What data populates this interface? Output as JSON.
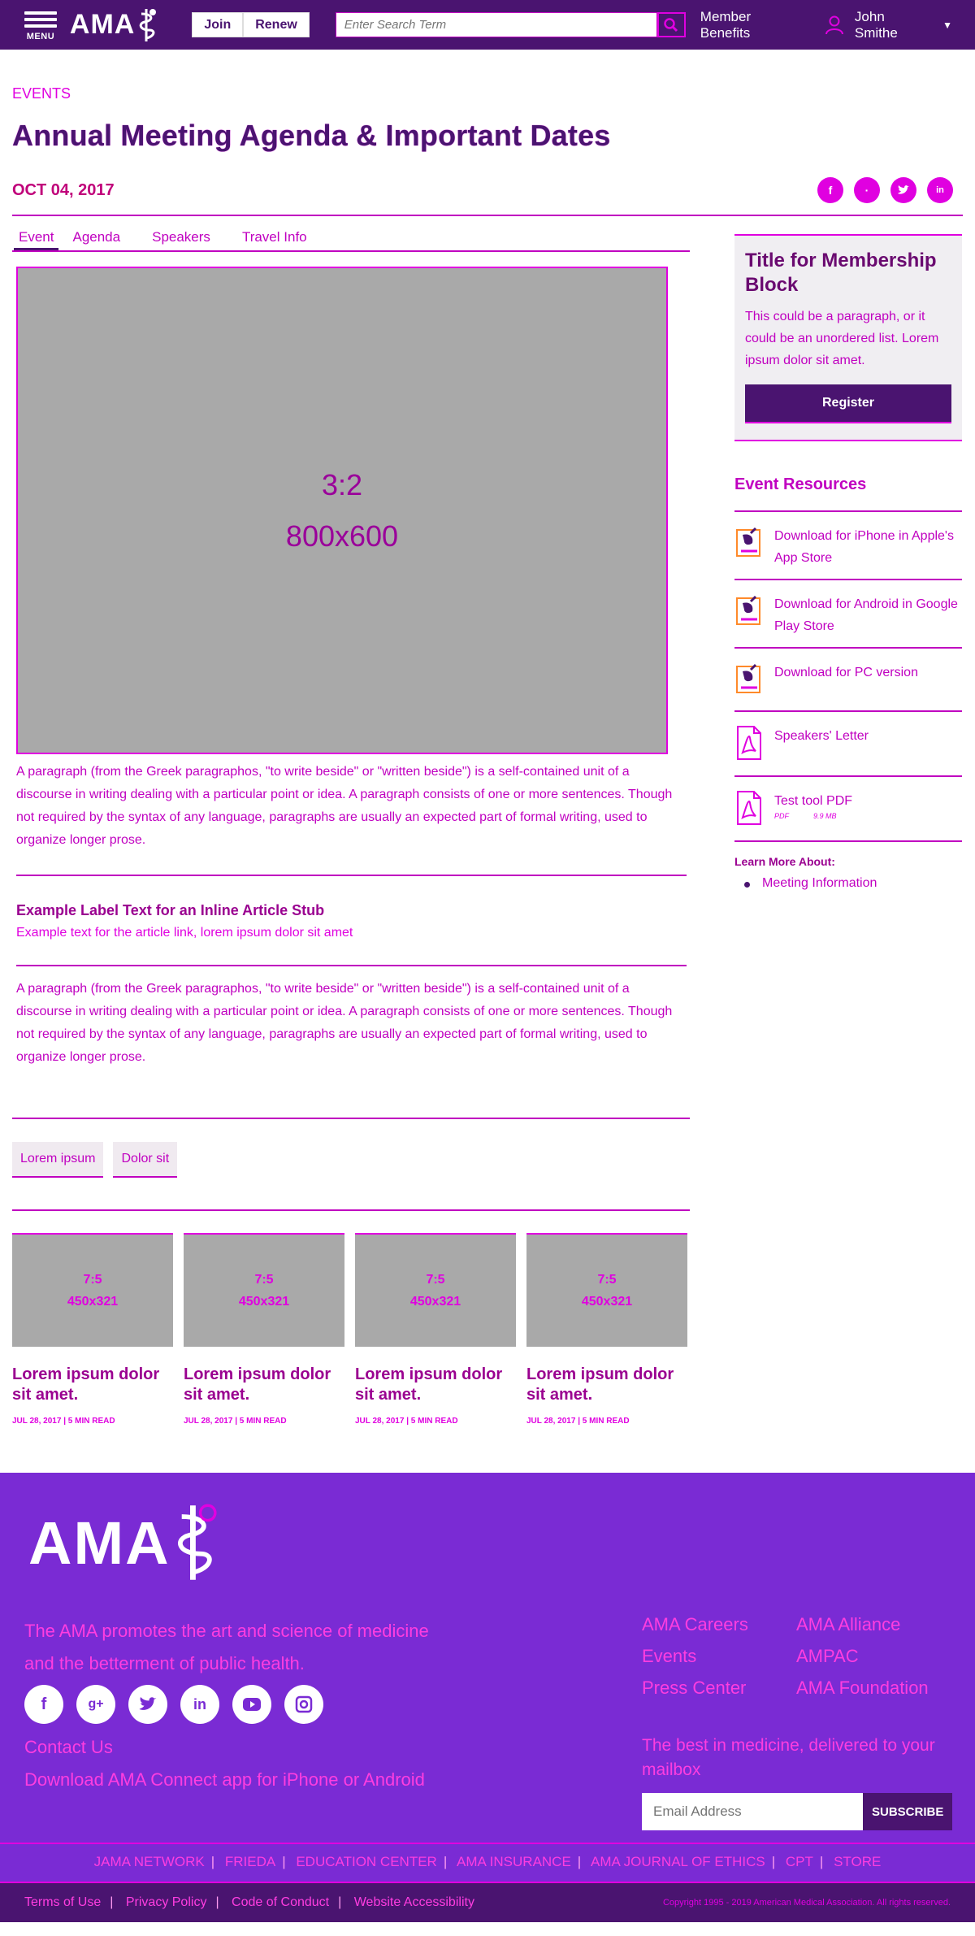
{
  "header": {
    "menu_label": "MENU",
    "logo": "AMA",
    "join_label": "Join",
    "renew_label": "Renew",
    "search_placeholder": "Enter Search Term",
    "member_benefits": "Member Benefits",
    "user_name": "John Smithe"
  },
  "page": {
    "eyebrow": "EVENTS",
    "title": "Annual Meeting Agenda & Important Dates",
    "date": "OCT 04, 2017",
    "share_icons": [
      "facebook",
      "google-plus",
      "twitter",
      "linkedin"
    ]
  },
  "tabs": [
    "Event",
    "Agenda",
    "Speakers",
    "Travel Info"
  ],
  "hero": {
    "ratio": "3:2",
    "size": "800x600"
  },
  "paragraph": "A paragraph (from the Greek paragraphos, \"to write beside\" or \"written beside\") is a self-contained unit of a discourse in writing dealing with a particular point or idea. A paragraph consists of one or more sentences. Though not required by the syntax of any language, paragraphs are usually an expected part of formal writing, used to organize longer prose.",
  "stub": {
    "label": "Example Label Text for an Inline Article Stub",
    "text": "Example text for the article link, lorem ipsum dolor sit amet"
  },
  "tags": [
    "Lorem ipsum",
    "Dolor sit"
  ],
  "cards": [
    {
      "ratio": "7:5",
      "size": "450x321",
      "title": "Lorem ipsum dolor sit amet.",
      "meta": "JUL 28, 2017 | 5 MIN READ"
    },
    {
      "ratio": "7:5",
      "size": "450x321",
      "title": "Lorem ipsum dolor sit amet.",
      "meta": "JUL 28, 2017 | 5 MIN READ"
    },
    {
      "ratio": "7:5",
      "size": "450x321",
      "title": "Lorem ipsum dolor sit amet.",
      "meta": "JUL 28, 2017 | 5 MIN READ"
    },
    {
      "ratio": "7:5",
      "size": "450x321",
      "title": "Lorem ipsum dolor sit amet.",
      "meta": "JUL 28, 2017 | 5 MIN READ"
    }
  ],
  "membership": {
    "title": "Title for Membership Block",
    "text": "This could be a paragraph, or it could be an unordered list. Lorem ipsum dolor sit amet.",
    "button": "Register"
  },
  "resources": {
    "heading": "Event Resources",
    "items": [
      {
        "icon": "app-download-icon",
        "label": "Download for iPhone in Apple's App Store"
      },
      {
        "icon": "app-download-icon",
        "label": "Download for Android in Google Play Store"
      },
      {
        "icon": "app-download-icon",
        "label": "Download for PC version"
      },
      {
        "icon": "pdf-icon",
        "label": "Speakers' Letter"
      },
      {
        "icon": "pdf-icon",
        "label": "Test tool PDF",
        "file_type": "PDF",
        "file_size": "9.9 MB"
      }
    ]
  },
  "learn_more": {
    "heading": "Learn More About:",
    "items": [
      "Meeting Information"
    ]
  },
  "footer": {
    "logo": "AMA",
    "tagline": "The AMA promotes the art and science of medicine and the betterment of public health.",
    "social": [
      "facebook",
      "google-plus",
      "twitter",
      "linkedin",
      "youtube",
      "instagram"
    ],
    "contact": "Contact Us",
    "app_text": "Download AMA Connect app for iPhone or Android",
    "links": [
      "AMA Careers",
      "AMA Alliance",
      "Events",
      "AMPAC",
      "Press Center",
      "AMA Foundation"
    ],
    "newsletter": "The best in medicine, delivered to your mailbox",
    "email_placeholder": "Email Address",
    "subscribe": "SUBSCRIBE",
    "network": [
      "JAMA NETWORK",
      "FRIEDA",
      "EDUCATION CENTER",
      "AMA INSURANCE",
      "AMA JOURNAL OF ETHICS",
      "CPT",
      "STORE"
    ],
    "bottom_links": [
      "Terms of Use",
      "Privacy Policy",
      "Code of Conduct",
      "Website Accessibility"
    ],
    "copyright": "Copyright 1995 - 2019 American Medical Association. All rights reserved."
  },
  "colors": {
    "header": "#4a1470",
    "accent": "#e000e0",
    "footer": "#7a2bd4"
  }
}
